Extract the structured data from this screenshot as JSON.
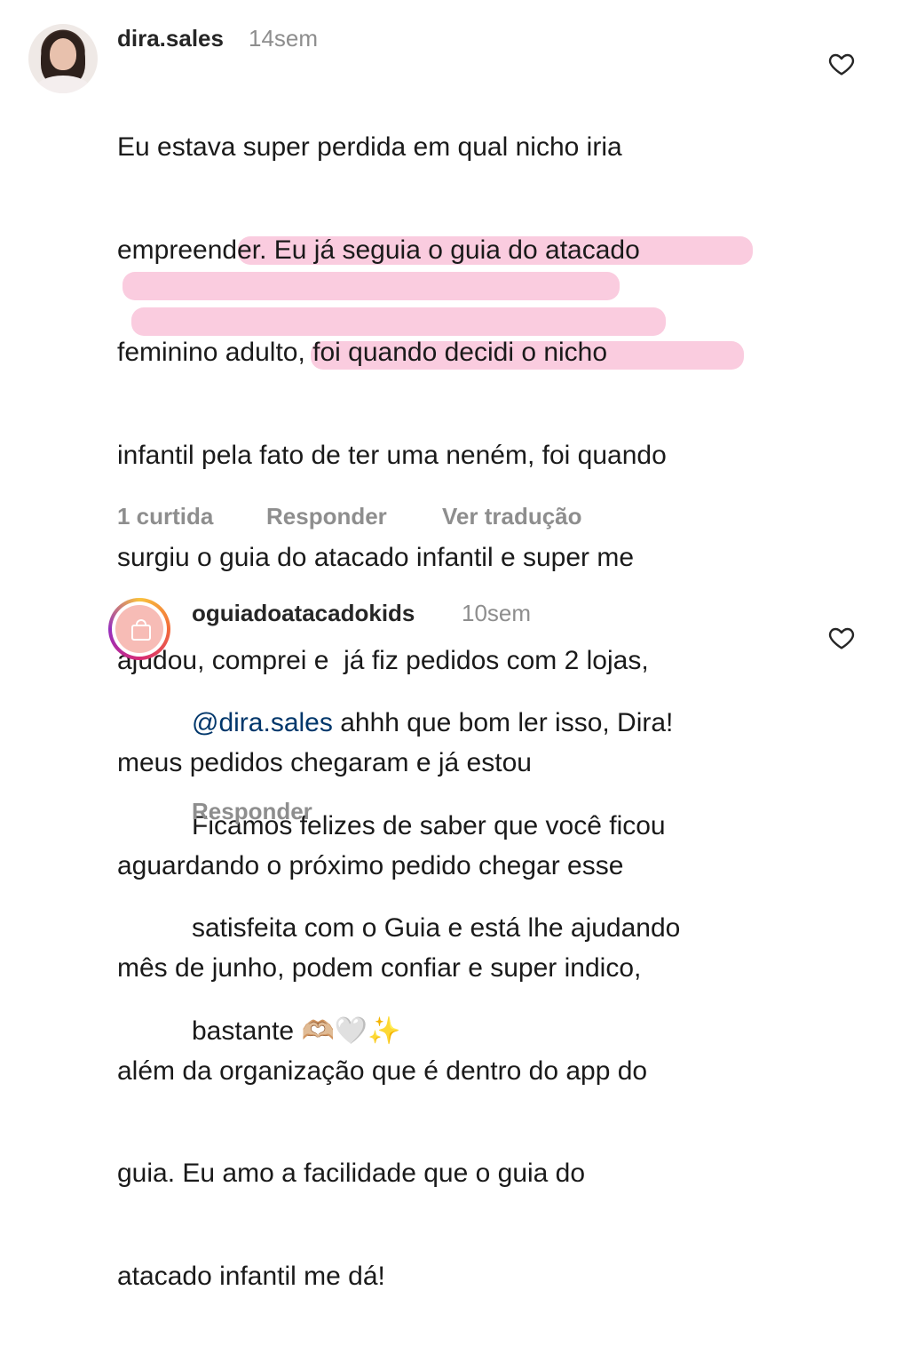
{
  "comments": [
    {
      "username": "dira.sales",
      "time": "14sem",
      "lines": [
        "Eu estava super perdida em qual nicho iria",
        "empreender. Eu já seguia o guia do atacado",
        "feminino adulto, foi quando decidi o nicho",
        "infantil pela fato de ter uma neném, foi quando",
        "surgiu o guia do atacado infantil e super me",
        "ajudou, comprei e  já fiz pedidos com 2 lojas,",
        "meus pedidos chegaram e já estou",
        "aguardando o próximo pedido chegar esse",
        "mês de junho, podem confiar e super indico,",
        "além da organização que é dentro do app do",
        "guia. Eu amo a facilidade que o guia do",
        "atacado infantil me dá!"
      ],
      "likes_label": "1 curtida",
      "reply_label": "Responder",
      "translate_label": "Ver tradução",
      "highlight_color": "#f378ac"
    },
    {
      "username": "oguiadoatacadokids",
      "time": "10sem",
      "mention": "@dira.sales",
      "lines": [
        " ahhh que bom ler isso, Dira!",
        "Ficamos felizes de saber que você ficou",
        "satisfeita com o Guia e está lhe ajudando",
        "bastante "
      ],
      "emojis": [
        "🫶🏼",
        "🤍",
        "✨"
      ],
      "reply_label": "Responder"
    }
  ],
  "colors": {
    "username": "#262626",
    "muted": "#8e8e8e",
    "mention": "#00376b",
    "text": "#1a1a1a"
  },
  "icons": {
    "like": "heart-outline-icon"
  }
}
